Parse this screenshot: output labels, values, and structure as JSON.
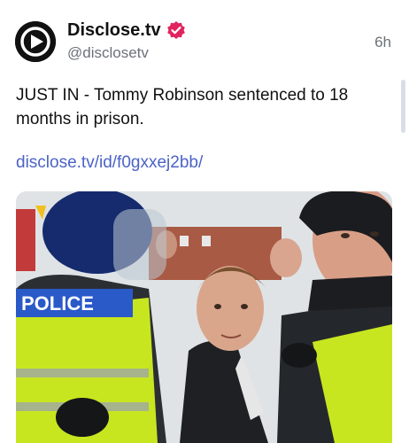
{
  "post": {
    "display_name": "Disclose.tv",
    "handle": "@disclosetv",
    "time": "6h",
    "text": "JUST IN - Tommy Robinson sentenced to 18 months in prison.",
    "link": "disclose.tv/id/f0gxxej2bb/",
    "verified": true
  },
  "media": {
    "vest_label": "POLICE"
  },
  "icons": {
    "avatar": "disclose-logo-icon",
    "verified": "verified-badge-icon"
  },
  "colors": {
    "link": "#4b63c6",
    "verified_badge": "#e0245e",
    "muted_text": "#6b7178",
    "hi_vis_yellow": "#c8e620"
  }
}
